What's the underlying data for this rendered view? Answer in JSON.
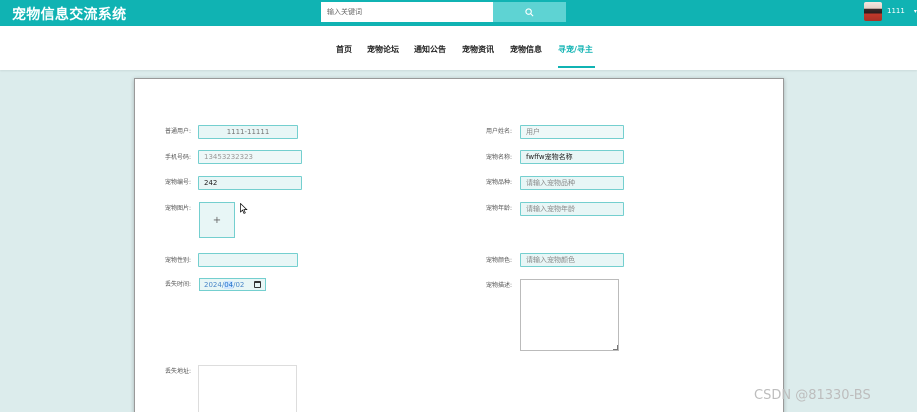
{
  "header": {
    "site_title": "宠物信息交流系统",
    "search_placeholder": "输入关键词",
    "user_name": "1111",
    "caret": "▾"
  },
  "nav": {
    "items": [
      {
        "label": "首页"
      },
      {
        "label": "宠物论坛"
      },
      {
        "label": "通知公告"
      },
      {
        "label": "宠物资讯"
      },
      {
        "label": "宠物信息"
      },
      {
        "label": "寻宠/寻主",
        "active": true
      }
    ]
  },
  "form": {
    "left": {
      "user_label": "普通用户:",
      "user_value": "1111-11111",
      "phone_label": "手机号码:",
      "phone_value": "13453232323",
      "pet_no_label": "宠物编号:",
      "pet_no_value": "242",
      "pet_image_label": "宠物图片:",
      "upload_plus": "+",
      "pet_gender_label": "宠物性别:",
      "pet_gender_value": "",
      "lost_time_label": "丢失时间:",
      "lost_time_year": "2024",
      "lost_time_month": "04",
      "lost_time_day": "02",
      "lost_addr_label": "丢失地址:"
    },
    "right": {
      "real_name_label": "用户姓名:",
      "real_name_placeholder": "用户",
      "pet_name_label": "宠物名称:",
      "pet_name_value": "fwffw宠物名称",
      "pet_breed_label": "宠物品种:",
      "pet_breed_placeholder": "请输入宠物品种",
      "pet_age_label": "宠物年龄:",
      "pet_age_placeholder": "请输入宠物年龄",
      "pet_color_label": "宠物颜色:",
      "pet_color_placeholder": "请输入宠物颜色",
      "pet_desc_label": "宠物描述:"
    }
  },
  "watermark": "CSDN @81330-BS",
  "colors": {
    "primary": "#10b3b3",
    "search_button": "#5ed3d3",
    "field_bg": "#e8f6f6",
    "field_border": "#74cfcf",
    "page_bg": "#dcecec"
  },
  "icons": {
    "search": "search-icon",
    "calendar": "calendar-icon",
    "cursor": "mouse-cursor-icon"
  }
}
